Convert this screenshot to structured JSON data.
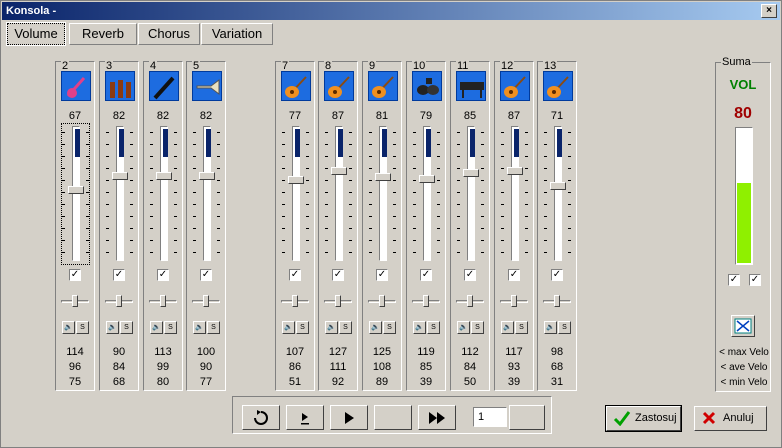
{
  "window": {
    "title": "Konsola -",
    "close_label": "×"
  },
  "tabs": [
    {
      "label": "Volume",
      "active": true
    },
    {
      "label": "Reverb",
      "active": false
    },
    {
      "label": "Chorus",
      "active": false
    },
    {
      "label": "Variation",
      "active": false
    }
  ],
  "channels": [
    {
      "num": "2",
      "instrument": "bass-guitar-icon",
      "value": "67",
      "level": 67,
      "max": "114",
      "ave": "96",
      "min": "75",
      "checked": "✓",
      "mute": "🔈",
      "solo": "S"
    },
    {
      "num": "3",
      "instrument": "strings-icon",
      "value": "82",
      "level": 82,
      "max": "90",
      "ave": "84",
      "min": "68",
      "checked": "✓",
      "mute": "🔈",
      "solo": "S"
    },
    {
      "num": "4",
      "instrument": "clarinet-icon",
      "value": "82",
      "level": 82,
      "max": "113",
      "ave": "99",
      "min": "80",
      "checked": "✓",
      "mute": "🔈",
      "solo": "S"
    },
    {
      "num": "5",
      "instrument": "trumpet-icon",
      "value": "82",
      "level": 82,
      "max": "100",
      "ave": "90",
      "min": "77",
      "checked": "✓",
      "mute": "🔈",
      "solo": "S"
    },
    {
      "num": "7",
      "instrument": "guitar-icon",
      "value": "77",
      "level": 77,
      "max": "107",
      "ave": "86",
      "min": "51",
      "checked": "✓",
      "mute": "🔈",
      "solo": "S"
    },
    {
      "num": "8",
      "instrument": "guitar-icon",
      "value": "87",
      "level": 87,
      "max": "127",
      "ave": "111",
      "min": "92",
      "checked": "✓",
      "mute": "🔈",
      "solo": "S"
    },
    {
      "num": "9",
      "instrument": "guitar-icon",
      "value": "81",
      "level": 81,
      "max": "125",
      "ave": "108",
      "min": "89",
      "checked": "✓",
      "mute": "🔈",
      "solo": "S"
    },
    {
      "num": "10",
      "instrument": "drum-kit-icon",
      "value": "79",
      "level": 79,
      "max": "119",
      "ave": "85",
      "min": "39",
      "checked": "✓",
      "mute": "🔈",
      "solo": "S"
    },
    {
      "num": "11",
      "instrument": "keyboard-icon",
      "value": "85",
      "level": 85,
      "max": "112",
      "ave": "84",
      "min": "50",
      "checked": "✓",
      "mute": "🔈",
      "solo": "S"
    },
    {
      "num": "12",
      "instrument": "guitar-icon",
      "value": "87",
      "level": 87,
      "max": "117",
      "ave": "93",
      "min": "39",
      "checked": "✓",
      "mute": "🔈",
      "solo": "S"
    },
    {
      "num": "13",
      "instrument": "guitar-icon",
      "value": "71",
      "level": 71,
      "max": "98",
      "ave": "68",
      "min": "31",
      "checked": "✓",
      "mute": "🔈",
      "solo": "S"
    }
  ],
  "suma": {
    "label": "Suma",
    "mode": "VOL",
    "total": "80",
    "level_fraction": 0.6,
    "check1": "✓",
    "check2": "✓",
    "max_label": "< max Velo",
    "ave_label": "< ave Velo",
    "min_label": "< min Velo"
  },
  "transport": {
    "page_value": "1",
    "icons": [
      "rewind-icon",
      "step-play-icon",
      "play-icon",
      "blank-button",
      "fast-forward-icon",
      "blank-button"
    ]
  },
  "buttons": {
    "apply_label": "Zastosuj",
    "cancel_label": "Anuluj"
  },
  "colors": {
    "title_start": "#0a246a",
    "instrument_bg": "#1d6ce0",
    "meter": "#8ff000",
    "vol": "#008000",
    "total": "#a00000"
  }
}
